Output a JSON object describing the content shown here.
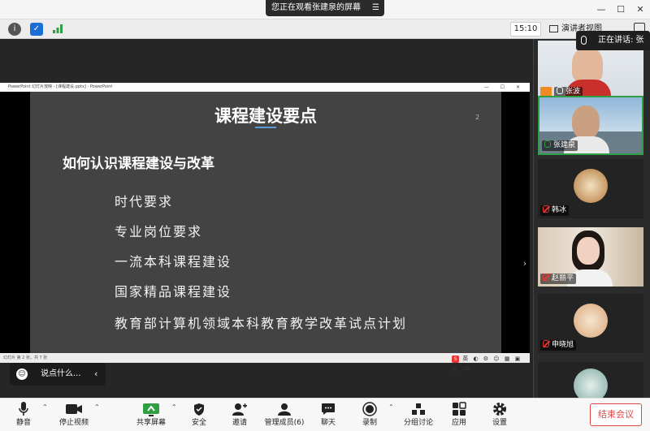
{
  "top": {
    "share_notice": "您正在观看张建泉的屏幕",
    "menu_icon": "hamburger-icon",
    "window_buttons": [
      "—",
      "☐",
      "✕"
    ]
  },
  "info": {
    "time": "15:10",
    "view_label": "演讲者视图",
    "speaking_label": "正在讲话: 张"
  },
  "ppt": {
    "window_title": "PowerPoint 幻灯片放映 - [课程建设.pptx] - PowerPoint",
    "slide": {
      "title": "课程建设要点",
      "number": "2",
      "heading": "如何认识课程建设与改革",
      "items": [
        "时代要求",
        "专业岗位要求",
        "一流本科课程建设",
        "国家精品课程建设",
        "教育部计算机领域本科教育教学改革试点计划"
      ]
    },
    "status_left": "幻灯片 第 2 张，共 7 张",
    "tray_badge": "S",
    "tray_text": "英"
  },
  "chat": {
    "placeholder": "说点什么..."
  },
  "gallery": {
    "participants": [
      {
        "name": "张波",
        "muted": false
      },
      {
        "name": "张建泉",
        "muted": false
      },
      {
        "name": "韩冰",
        "muted": true
      },
      {
        "name": "赵丽平",
        "muted": true
      },
      {
        "name": "申晓旭",
        "muted": true
      }
    ]
  },
  "toolbar": {
    "mute": "静音",
    "stop_video": "停止视频",
    "share_screen": "共享屏幕",
    "security": "安全",
    "invite": "邀请",
    "manage_members": "管理成员(6)",
    "chat": "聊天",
    "record": "录制",
    "breakout": "分组讨论",
    "apps": "应用",
    "settings": "设置",
    "end_meeting": "结束会议"
  },
  "colors": {
    "end_red": "#e54545",
    "accent_green": "#2ea043",
    "slide_bg": "#434343"
  }
}
